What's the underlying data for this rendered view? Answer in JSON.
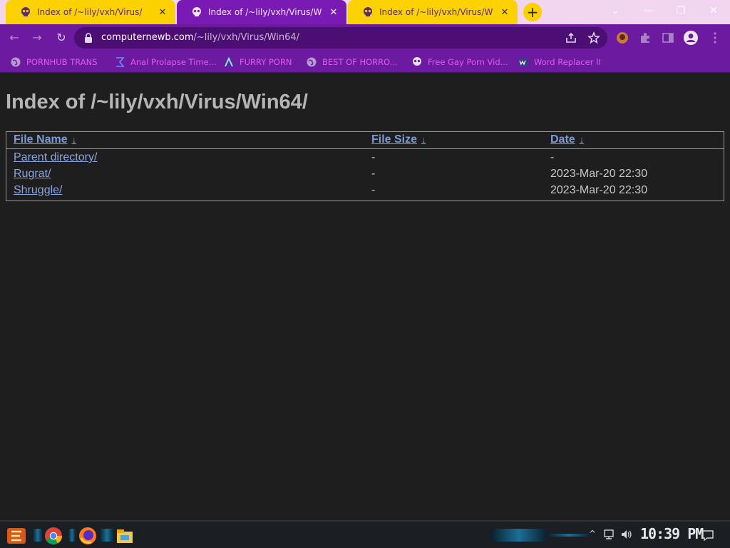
{
  "tabs": [
    {
      "title": "Index of /~lily/vxh/Virus/",
      "close": "✕"
    },
    {
      "title": "Index of /~lily/vxh/Virus/Win",
      "close": "✕"
    },
    {
      "title": "Index of /~lily/vxh/Virus/Win",
      "close": "✕"
    }
  ],
  "new_tab": "+",
  "window_controls": {
    "tab_search": "⌄",
    "minimize": "—",
    "restore": "❐",
    "close": "✕"
  },
  "toolbar": {
    "back": "←",
    "forward": "→",
    "reload": "↻"
  },
  "address": {
    "host": "computernewb.com",
    "path": "/~lily/vxh/Virus/Win64/"
  },
  "bookmarks": [
    {
      "label": "PORNHUB TRANS",
      "icon": "globe-icon"
    },
    {
      "label": "Anal Prolapse Time...",
      "icon": "sigma-icon"
    },
    {
      "label": "FURRY PORN",
      "icon": "lambda-icon"
    },
    {
      "label": "BEST OF HORRO...",
      "icon": "globe-icon"
    },
    {
      "label": "Free Gay Porn Vid...",
      "icon": "skull-icon"
    },
    {
      "label": "Word Replacer II",
      "icon": "wr-icon"
    }
  ],
  "page": {
    "title": "Index of /~lily/vxh/Virus/Win64/",
    "columns": {
      "name": "File Name",
      "size": "File Size",
      "date": "Date",
      "sort_indicator": "↓"
    },
    "rows": [
      {
        "name": "Parent directory/",
        "size": "-",
        "date": "-"
      },
      {
        "name": "Rugrat/",
        "size": "-",
        "date": "2023-Mar-20 22:30"
      },
      {
        "name": "Shruggle/",
        "size": "-",
        "date": "2023-Mar-20 22:30"
      }
    ]
  },
  "taskbar": {
    "clock": "10:39 PM"
  },
  "colors": {
    "tab_active": "#7a1ab5",
    "tab_inactive": "#fbd100",
    "toolbar": "#6c1aa0",
    "bookmark_text": "#e05cf0",
    "link": "#8aa6e0",
    "page_bg": "#1e1e1e"
  }
}
